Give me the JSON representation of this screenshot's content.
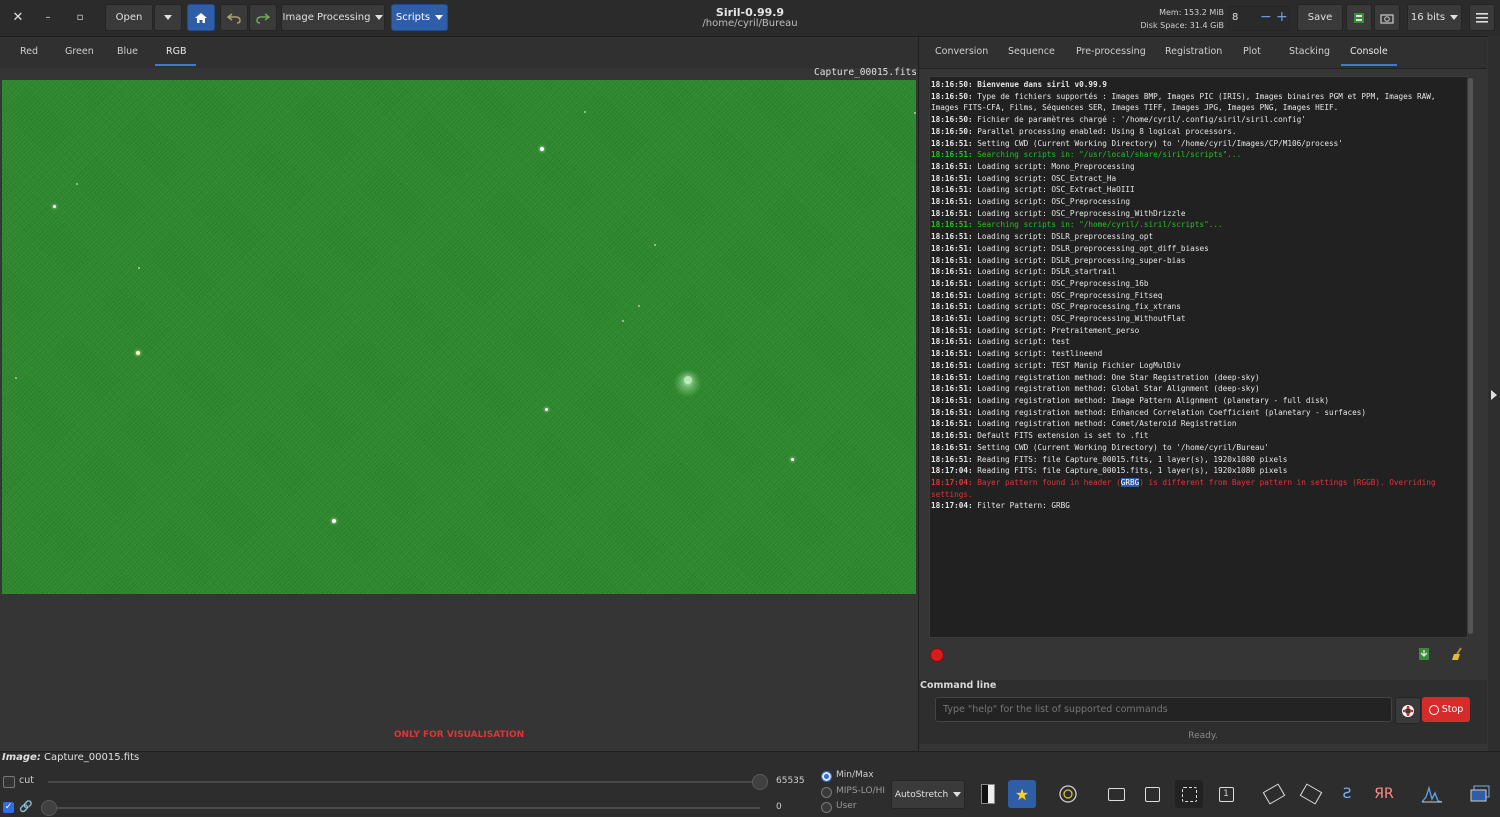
{
  "header": {
    "close": "✕",
    "minimize": "–",
    "maximize": "▫",
    "open_label": "Open",
    "image_processing": "Image Processing",
    "scripts": "Scripts",
    "title": "Siril-0.99.9",
    "path": "/home/cyril/Bureau",
    "mem": "Mem: 153.2  MiB",
    "disk": "Disk Space: 31.4  GiB",
    "threads": "8",
    "save": "Save",
    "bits": "16 bits"
  },
  "left_tabs": [
    "Red",
    "Green",
    "Blue",
    "RGB"
  ],
  "right_tabs": [
    "Conversion",
    "Sequence",
    "Pre-processing",
    "Registration",
    "Plot",
    "Stacking",
    "Console"
  ],
  "image": {
    "filename_tag": "Capture_00015.fits",
    "only_visualisation": "ONLY FOR VISUALISATION",
    "info_label": "Image:",
    "info_file": "Capture_00015.fits"
  },
  "console": {
    "lines": [
      {
        "t": "18:16:50:",
        "m": " Bienvenue dans siril v0.99.9",
        "c": "bold"
      },
      {
        "t": "18:16:50:",
        "m": " Type de fichiers supportés : Images BMP, Images PIC (IRIS), Images binaires PGM et PPM, Images RAW, Images FITS-CFA, Films, Séquences SER, Images TIFF, Images JPG, Images PNG, Images HEIF.",
        "c": ""
      },
      {
        "t": "18:16:50:",
        "m": " Fichier de paramètres chargé : '/home/cyril/.config/siril/siril.config'",
        "c": ""
      },
      {
        "t": "18:16:50:",
        "m": " Parallel processing enabled: Using 8 logical processors.",
        "c": ""
      },
      {
        "t": "18:16:51:",
        "m": " Setting CWD (Current Working Directory) to '/home/cyril/Images/CP/M106/process'",
        "c": ""
      },
      {
        "t": "18:16:51:",
        "m": " Searching scripts in: \"/usr/local/share/siril/scripts\"...",
        "c": "green"
      },
      {
        "t": "18:16:51:",
        "m": " Loading script: Mono_Preprocessing",
        "c": ""
      },
      {
        "t": "18:16:51:",
        "m": " Loading script: OSC_Extract_Ha",
        "c": ""
      },
      {
        "t": "18:16:51:",
        "m": " Loading script: OSC_Extract_HaOIII",
        "c": ""
      },
      {
        "t": "18:16:51:",
        "m": " Loading script: OSC_Preprocessing",
        "c": ""
      },
      {
        "t": "18:16:51:",
        "m": " Loading script: OSC_Preprocessing_WithDrizzle",
        "c": ""
      },
      {
        "t": "18:16:51:",
        "m": " Searching scripts in: \"/home/cyril/.siril/scripts\"...",
        "c": "green"
      },
      {
        "t": "18:16:51:",
        "m": " Loading script: DSLR_preprocessing_opt",
        "c": ""
      },
      {
        "t": "18:16:51:",
        "m": " Loading script: DSLR_preprocessing_opt_diff_biases",
        "c": ""
      },
      {
        "t": "18:16:51:",
        "m": " Loading script: DSLR_preprocessing_super-bias",
        "c": ""
      },
      {
        "t": "18:16:51:",
        "m": " Loading script: DSLR_startrail",
        "c": ""
      },
      {
        "t": "18:16:51:",
        "m": " Loading script: OSC_Preprocessing_16b",
        "c": ""
      },
      {
        "t": "18:16:51:",
        "m": " Loading script: OSC_Preprocessing_Fitseq",
        "c": ""
      },
      {
        "t": "18:16:51:",
        "m": " Loading script: OSC_Preprocessing_fix_xtrans",
        "c": ""
      },
      {
        "t": "18:16:51:",
        "m": " Loading script: OSC_Preprocessing_WithoutFlat",
        "c": ""
      },
      {
        "t": "18:16:51:",
        "m": " Loading script: Pretraitement_perso",
        "c": ""
      },
      {
        "t": "18:16:51:",
        "m": " Loading script: test",
        "c": ""
      },
      {
        "t": "18:16:51:",
        "m": " Loading script: testlineend",
        "c": ""
      },
      {
        "t": "18:16:51:",
        "m": " Loading script: TEST Manip Fichier LogMulDiv",
        "c": ""
      },
      {
        "t": "18:16:51:",
        "m": " Loading registration method: One Star Registration (deep-sky)",
        "c": ""
      },
      {
        "t": "18:16:51:",
        "m": " Loading registration method: Global Star Alignment (deep-sky)",
        "c": ""
      },
      {
        "t": "18:16:51:",
        "m": " Loading registration method: Image Pattern Alignment (planetary - full disk)",
        "c": ""
      },
      {
        "t": "18:16:51:",
        "m": " Loading registration method: Enhanced Correlation Coefficient (planetary - surfaces)",
        "c": ""
      },
      {
        "t": "18:16:51:",
        "m": " Loading registration method: Comet/Asteroid Registration",
        "c": ""
      },
      {
        "t": "18:16:51:",
        "m": " Default FITS extension is set to .fit",
        "c": ""
      },
      {
        "t": "18:16:51:",
        "m": " Setting CWD (Current Working Directory) to '/home/cyril/Bureau'",
        "c": ""
      },
      {
        "t": "18:16:51:",
        "m": " Reading FITS: file Capture_00015.fits, 1 layer(s), 1920x1080 pixels",
        "c": ""
      },
      {
        "t": "18:17:04:",
        "m": " Reading FITS: file Capture_00015.fits, 1 layer(s), 1920x1080 pixels",
        "c": ""
      },
      {
        "t": "18:17:04:",
        "m": " Bayer pattern found in header (",
        "hl": "GRBG",
        "m2": ") is different from Bayer pattern in settings (RGGB). Overriding settings.",
        "c": "red"
      },
      {
        "t": "18:17:04:",
        "m": " Filter Pattern: GRBG",
        "c": ""
      }
    ]
  },
  "command_line": {
    "label": "Command line",
    "placeholder": "Type \"help\" for the list of supported commands",
    "stop": "Stop",
    "status": "Ready."
  },
  "bottom": {
    "cut": "cut",
    "max_value": "65535",
    "min_value": "0",
    "radio": [
      "Min/Max",
      "MIPS-LO/HI",
      "User"
    ],
    "stretch": "AutoStretch"
  },
  "colors": {
    "accent": "#3d7ad6",
    "image_green": "#2b8a2b",
    "stop_red": "#d62b2b"
  }
}
